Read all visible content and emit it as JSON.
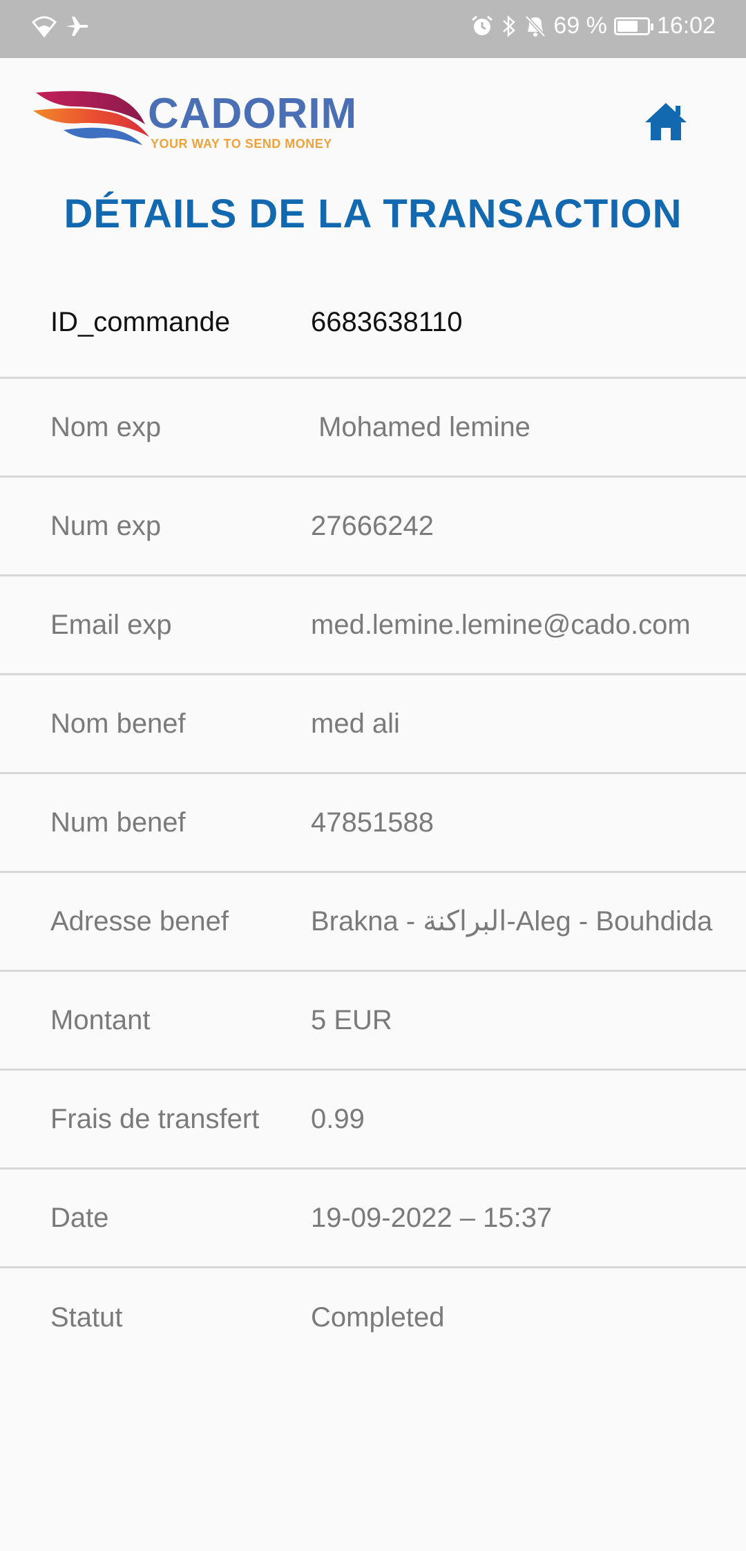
{
  "status_bar": {
    "battery": "69 %",
    "battery_level": 0.69,
    "time": "16:02",
    "icons_left": [
      "wifi-icon",
      "airplane-icon"
    ],
    "icons_right": [
      "alarm-icon",
      "bluetooth-icon",
      "bell-off-icon",
      "battery-icon"
    ]
  },
  "header": {
    "brand_name": "CADORIM",
    "tagline": "YOUR WAY TO SEND MONEY",
    "home_icon": "home-icon",
    "brand_colors": {
      "name": "#4a6fb5",
      "tagline": "#f0a23a",
      "home": "#1269b0"
    }
  },
  "page": {
    "title": "DÉTAILS DE LA TRANSACTION",
    "title_color": "#1269b0"
  },
  "details": [
    {
      "label": "ID_commande",
      "value": "6683638110"
    },
    {
      "label": "Nom exp",
      "value": " Mohamed lemine"
    },
    {
      "label": "Num exp",
      "value": "27666242"
    },
    {
      "label": "Email exp",
      "value": "med.lemine.lemine@cado.com"
    },
    {
      "label": "Nom benef",
      "value": "med ali"
    },
    {
      "label": "Num benef",
      "value": "47851588"
    },
    {
      "label": "Adresse benef",
      "value": "Brakna - البراكنة-Aleg - Bouhdida"
    },
    {
      "label": "Montant",
      "value": "5 EUR"
    },
    {
      "label": "Frais de transfert",
      "value": "0.99"
    },
    {
      "label": "Date",
      "value": "19-09-2022 – 15:37"
    },
    {
      "label": "Statut",
      "value": "Completed"
    }
  ]
}
